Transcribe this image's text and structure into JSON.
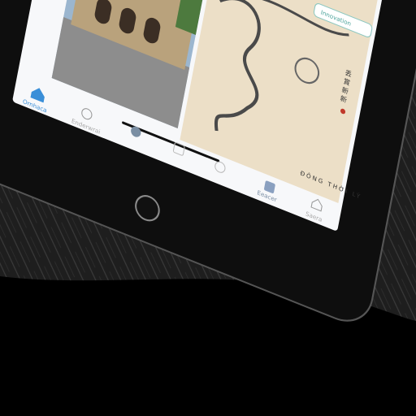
{
  "scene": {
    "background_color": "#202020",
    "tablet_color": "#111111",
    "screen_bg": "#f7f8fa",
    "accent": "#3a8fd8"
  },
  "header": {
    "badge_label": "Innovation"
  },
  "artwork": {
    "caption": "ĐÔNG THỜI LÝ",
    "seal_text": "丢 賞 新 新"
  },
  "tabbar": {
    "items": [
      {
        "label": "Ornhaca",
        "icon": "home-icon",
        "active": true
      },
      {
        "label": "Enderwrai",
        "icon": "circle-icon",
        "active": false
      },
      {
        "label": "",
        "icon": "chat-icon",
        "active": false
      },
      {
        "label": "",
        "icon": "grid-icon",
        "active": false
      },
      {
        "label": "",
        "icon": "smile-icon",
        "active": false
      },
      {
        "label": "Eeacer",
        "icon": "calendar-icon",
        "active": false
      },
      {
        "label": "Saera",
        "icon": "cloud-icon",
        "active": false
      }
    ]
  }
}
